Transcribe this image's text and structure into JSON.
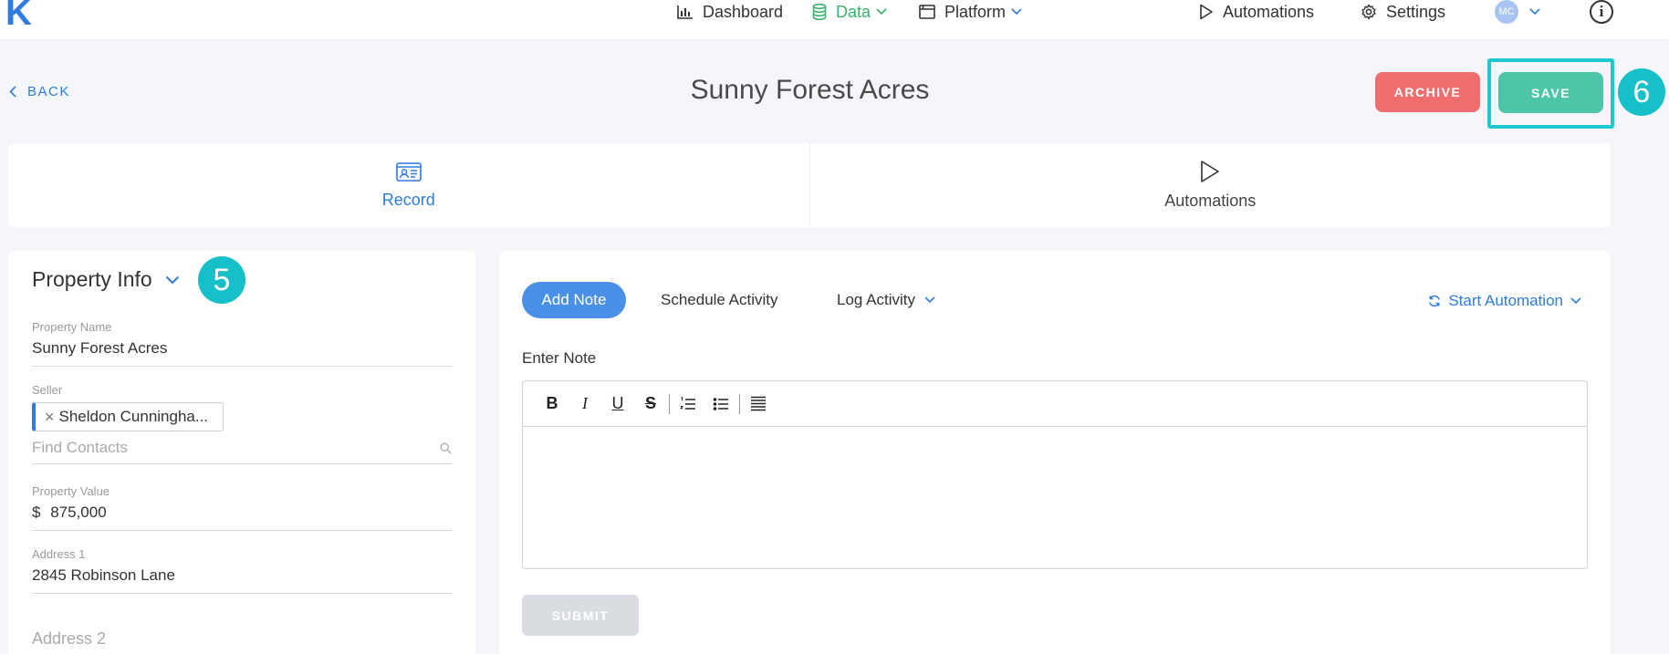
{
  "brand": {
    "logo_letter": "K",
    "accent": "#2f7be0"
  },
  "nav": {
    "dashboard": "Dashboard",
    "data": "Data",
    "platform": "Platform",
    "automations": "Automations",
    "settings": "Settings",
    "user_initials": "MC"
  },
  "header": {
    "back_label": "BACK",
    "title": "Sunny Forest Acres",
    "archive_label": "ARCHIVE",
    "save_label": "SAVE"
  },
  "badges": {
    "save_step": "6",
    "property_step": "5"
  },
  "tabs": [
    {
      "label": "Record",
      "icon": "contact-card-icon",
      "active": true
    },
    {
      "label": "Automations",
      "icon": "play-icon",
      "active": false
    }
  ],
  "property": {
    "title": "Property Info",
    "name_label": "Property Name",
    "name_value": "Sunny Forest Acres",
    "seller_label": "Seller",
    "seller_chip": "Sheldon Cunningha...",
    "find_contacts_placeholder": "Find Contacts",
    "value_label": "Property Value",
    "value_currency": "$",
    "value_amount": "875,000",
    "address1_label": "Address 1",
    "address1_value": "2845 Robinson Lane",
    "address2_placeholder": "Address 2"
  },
  "activity": {
    "add_note": "Add Note",
    "schedule": "Schedule Activity",
    "log": "Log Activity",
    "start_automation": "Start Automation",
    "enter_note": "Enter Note",
    "submit": "SUBMIT"
  },
  "editor_toolbar": {
    "bold": "B",
    "italic": "I",
    "underline": "U",
    "strike": "S"
  },
  "colors": {
    "save": "#4cc6a7",
    "archive": "#f06e6e",
    "badge": "#15c0c8",
    "data_active": "#3ab26b"
  }
}
